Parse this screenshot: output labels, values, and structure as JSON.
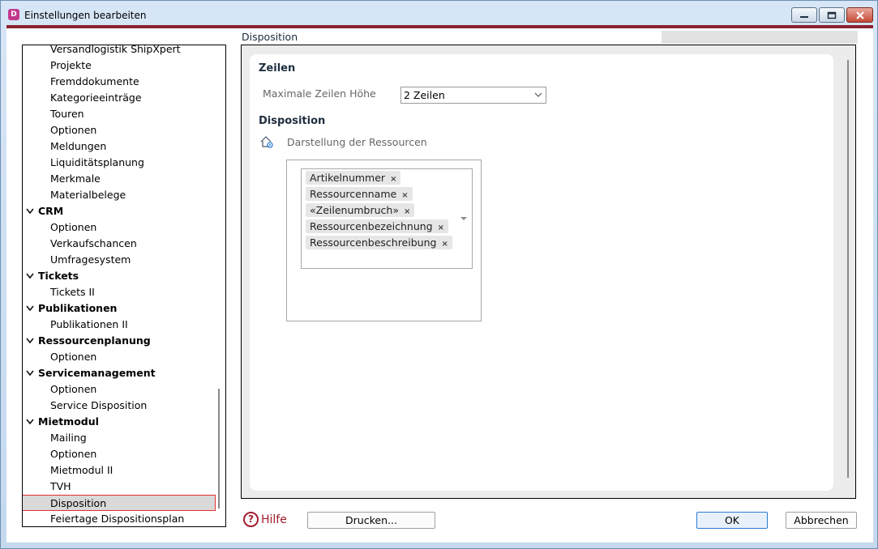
{
  "window": {
    "title": "Einstellungen bearbeiten",
    "app_icon": "D"
  },
  "tree": {
    "items": [
      {
        "label": "Versandlogistik ShipXpert",
        "level": "child"
      },
      {
        "label": "Projekte",
        "level": "child"
      },
      {
        "label": "Fremddokumente",
        "level": "child"
      },
      {
        "label": "Kategorieeinträge",
        "level": "child"
      },
      {
        "label": "Touren",
        "level": "child"
      },
      {
        "label": "Optionen",
        "level": "child"
      },
      {
        "label": "Meldungen",
        "level": "child"
      },
      {
        "label": "Liquiditätsplanung",
        "level": "child"
      },
      {
        "label": "Merkmale",
        "level": "child"
      },
      {
        "label": "Materialbelege",
        "level": "child"
      },
      {
        "label": "CRM",
        "level": "parent"
      },
      {
        "label": "Optionen",
        "level": "child"
      },
      {
        "label": "Verkaufschancen",
        "level": "child"
      },
      {
        "label": "Umfragesystem",
        "level": "child"
      },
      {
        "label": "Tickets",
        "level": "parent"
      },
      {
        "label": "Tickets II",
        "level": "child"
      },
      {
        "label": "Publikationen",
        "level": "parent"
      },
      {
        "label": "Publikationen II",
        "level": "child"
      },
      {
        "label": "Ressourcenplanung",
        "level": "parent"
      },
      {
        "label": "Optionen",
        "level": "child"
      },
      {
        "label": "Servicemanagement",
        "level": "parent"
      },
      {
        "label": "Optionen",
        "level": "child"
      },
      {
        "label": "Service Disposition",
        "level": "child"
      },
      {
        "label": "Mietmodul",
        "level": "parent"
      },
      {
        "label": "Mailing",
        "level": "child"
      },
      {
        "label": "Optionen",
        "level": "child"
      },
      {
        "label": "Mietmodul II",
        "level": "child"
      },
      {
        "label": "TVH",
        "level": "child"
      },
      {
        "label": "Disposition",
        "level": "child",
        "selected": true
      },
      {
        "label": "Feiertage Dispositionsplan",
        "level": "child"
      }
    ]
  },
  "panel": {
    "header": "Disposition",
    "zeilen": {
      "title": "Zeilen",
      "max_height_label": "Maximale Zeilen Höhe",
      "max_height_value": "2 Zeilen"
    },
    "disposition": {
      "title": "Disposition",
      "resources_label": "Darstellung der Ressourcen",
      "resources_icon": "house-gear-icon",
      "chips": [
        "Artikelnummer",
        "Ressourcenname",
        "«Zeilenumbruch»",
        "Ressourcenbezeichnung",
        "Ressourcenbeschreibung"
      ],
      "remove_glyph": "×"
    }
  },
  "footer": {
    "help_label": "Hilfe",
    "help_glyph": "?",
    "print_label": "Drucken...",
    "ok_label": "OK",
    "cancel_label": "Abbrechen"
  },
  "colors": {
    "accent": "#8b2230",
    "help": "#a11d2d",
    "selection_border": "#e03030"
  }
}
